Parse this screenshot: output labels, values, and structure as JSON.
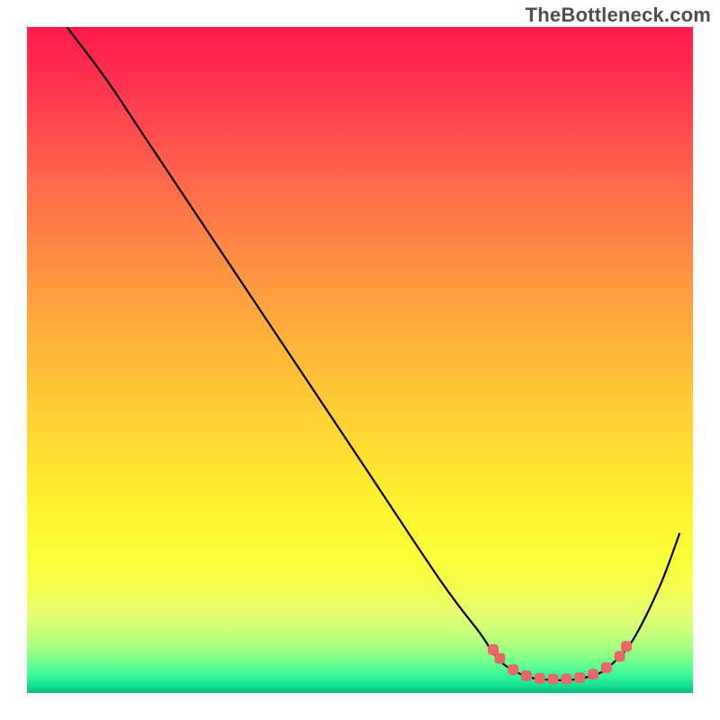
{
  "watermark": "TheBottleneck.com",
  "chart_data": {
    "type": "line",
    "title": "",
    "xlabel": "",
    "ylabel": "",
    "xlim": [
      0,
      100
    ],
    "ylim": [
      0,
      100
    ],
    "grid": false,
    "series": [
      {
        "name": "curve",
        "stroke": "#000000",
        "stroke_width": 2.2,
        "fill": "none",
        "points": [
          {
            "x": 6,
            "y": 100
          },
          {
            "x": 12,
            "y": 92
          },
          {
            "x": 18,
            "y": 83
          },
          {
            "x": 30,
            "y": 65
          },
          {
            "x": 50,
            "y": 35
          },
          {
            "x": 62,
            "y": 17
          },
          {
            "x": 68,
            "y": 9
          },
          {
            "x": 70,
            "y": 6
          },
          {
            "x": 72,
            "y": 4
          },
          {
            "x": 75,
            "y": 2.5
          },
          {
            "x": 78,
            "y": 2
          },
          {
            "x": 82,
            "y": 2
          },
          {
            "x": 86,
            "y": 3
          },
          {
            "x": 88,
            "y": 4.5
          },
          {
            "x": 91,
            "y": 8
          },
          {
            "x": 95,
            "y": 16
          },
          {
            "x": 98,
            "y": 24
          }
        ]
      },
      {
        "name": "markers",
        "marker_color": "#e86767",
        "marker_shape": "rounded",
        "points": [
          {
            "x": 70,
            "y": 6.5
          },
          {
            "x": 71,
            "y": 5.2
          },
          {
            "x": 73,
            "y": 3.5
          },
          {
            "x": 75,
            "y": 2.6
          },
          {
            "x": 77,
            "y": 2.2
          },
          {
            "x": 79,
            "y": 2.1
          },
          {
            "x": 81,
            "y": 2.1
          },
          {
            "x": 83,
            "y": 2.3
          },
          {
            "x": 85,
            "y": 2.8
          },
          {
            "x": 87,
            "y": 3.8
          },
          {
            "x": 89,
            "y": 5.5
          },
          {
            "x": 90,
            "y": 7.0
          }
        ]
      }
    ],
    "gradient_bands": {
      "comment": "Vertical gradient from top to bottom filling plot area",
      "stops": [
        {
          "pos": 0.0,
          "color": "#ff1a4b"
        },
        {
          "pos": 0.1,
          "color": "#ff3850"
        },
        {
          "pos": 0.25,
          "color": "#ff6e4a"
        },
        {
          "pos": 0.42,
          "color": "#ffa43e"
        },
        {
          "pos": 0.58,
          "color": "#ffd033"
        },
        {
          "pos": 0.72,
          "color": "#fff22f"
        },
        {
          "pos": 0.8,
          "color": "#fcff3a"
        },
        {
          "pos": 0.85,
          "color": "#f4ff55"
        },
        {
          "pos": 0.88,
          "color": "#e6ff70"
        },
        {
          "pos": 0.91,
          "color": "#c8ff7a"
        },
        {
          "pos": 0.935,
          "color": "#9dff82"
        },
        {
          "pos": 0.955,
          "color": "#6bff8f"
        },
        {
          "pos": 0.975,
          "color": "#35f79c"
        },
        {
          "pos": 0.988,
          "color": "#14e48f"
        },
        {
          "pos": 1.0,
          "color": "#0fb878"
        }
      ]
    }
  }
}
